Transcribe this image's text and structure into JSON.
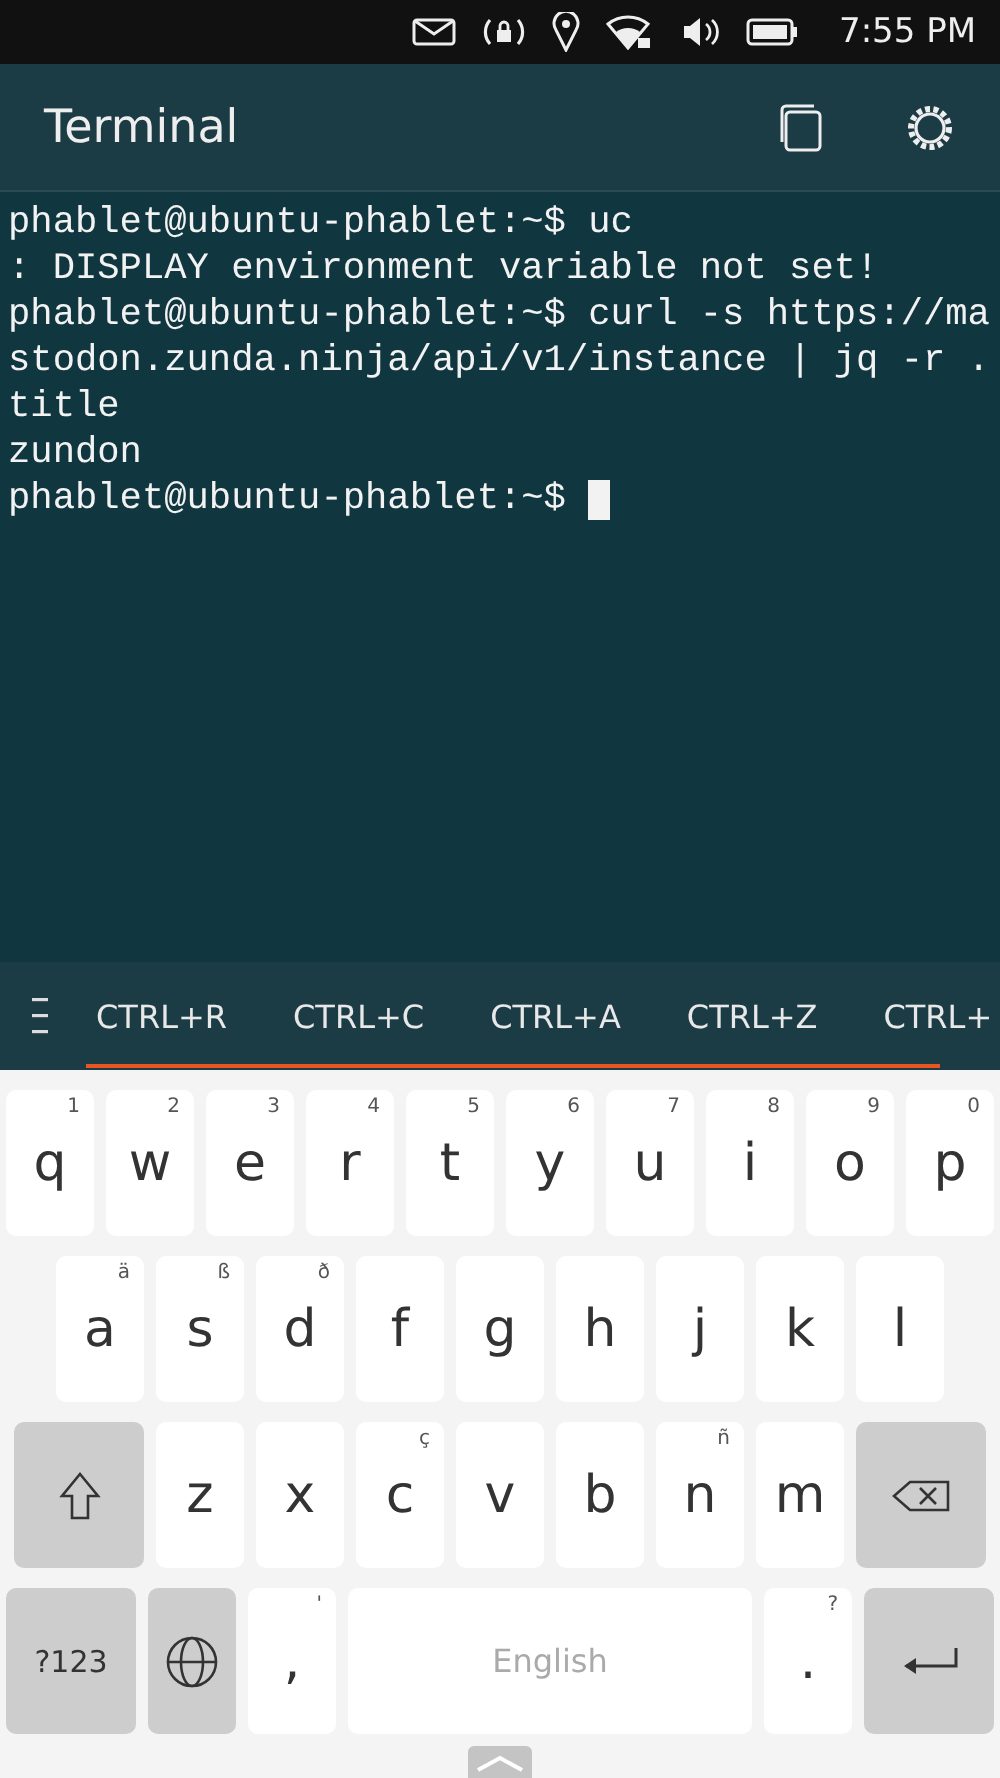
{
  "status_bar": {
    "time": "7:55 PM"
  },
  "header": {
    "title": "Terminal"
  },
  "terminal": {
    "lines": [
      "phablet@ubuntu-phablet:~$ uc",
      ": DISPLAY environment variable not set!",
      "phablet@ubuntu-phablet:~$ curl -s https://ma",
      "stodon.zunda.ninja/api/v1/instance | jq -r .",
      "title",
      "zundon",
      "phablet@ubuntu-phablet:~$ "
    ]
  },
  "shortcuts": [
    "CTRL+R",
    "CTRL+C",
    "CTRL+A",
    "CTRL+Z",
    "CTRL+"
  ],
  "keyboard": {
    "key_rows": [
      {
        "keys": [
          {
            "kind": "letter",
            "label": "q",
            "hint": "1"
          },
          {
            "kind": "letter",
            "label": "w",
            "hint": "2"
          },
          {
            "kind": "letter",
            "label": "e",
            "hint": "3"
          },
          {
            "kind": "letter",
            "label": "r",
            "hint": "4"
          },
          {
            "kind": "letter",
            "label": "t",
            "hint": "5"
          },
          {
            "kind": "letter",
            "label": "y",
            "hint": "6"
          },
          {
            "kind": "letter",
            "label": "u",
            "hint": "7"
          },
          {
            "kind": "letter",
            "label": "i",
            "hint": "8"
          },
          {
            "kind": "letter",
            "label": "o",
            "hint": "9"
          },
          {
            "kind": "letter",
            "label": "p",
            "hint": "0"
          }
        ]
      },
      {
        "keys": [
          {
            "kind": "letter",
            "label": "a",
            "hint": "ä"
          },
          {
            "kind": "letter",
            "label": "s",
            "hint": "ß"
          },
          {
            "kind": "letter",
            "label": "d",
            "hint": "ð"
          },
          {
            "kind": "letter",
            "label": "f"
          },
          {
            "kind": "letter",
            "label": "g"
          },
          {
            "kind": "letter",
            "label": "h"
          },
          {
            "kind": "letter",
            "label": "j"
          },
          {
            "kind": "letter",
            "label": "k"
          },
          {
            "kind": "letter",
            "label": "l"
          }
        ]
      },
      {
        "keys": [
          {
            "kind": "shift"
          },
          {
            "kind": "letter",
            "label": "z"
          },
          {
            "kind": "letter",
            "label": "x"
          },
          {
            "kind": "letter",
            "label": "c",
            "hint": "ç"
          },
          {
            "kind": "letter",
            "label": "v"
          },
          {
            "kind": "letter",
            "label": "b"
          },
          {
            "kind": "letter",
            "label": "n",
            "hint": "ñ"
          },
          {
            "kind": "letter",
            "label": "m"
          },
          {
            "kind": "backspace"
          }
        ]
      },
      {
        "keys": [
          {
            "kind": "symbols",
            "label": "?123"
          },
          {
            "kind": "globe"
          },
          {
            "kind": "letter",
            "label": ",",
            "hint": "'"
          },
          {
            "kind": "space",
            "label": "English"
          },
          {
            "kind": "letter",
            "label": ".",
            "hint": "?"
          },
          {
            "kind": "enter"
          }
        ]
      }
    ]
  }
}
